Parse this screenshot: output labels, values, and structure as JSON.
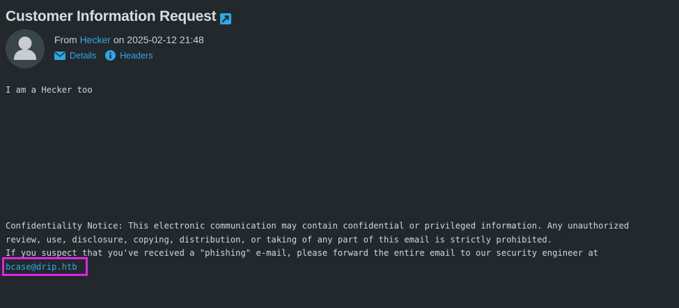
{
  "message": {
    "subject": "Customer Information Request",
    "from_prefix": "From",
    "from_name": "Hecker",
    "date_prefix": "on",
    "date": "2025-02-12 21:48",
    "links": {
      "details": "Details",
      "headers": "Headers"
    },
    "body_text": "I am a Hecker too",
    "notice_lines": [
      "Confidentiality Notice: This electronic communication may contain confidential or privileged information. Any unauthorized",
      "review, use, disclosure, copying, distribution, or taking of any part of this email is strictly prohibited.",
      "If you suspect that you've received a \"phishing\" e-mail, please forward the entire email to our security engineer at"
    ],
    "security_email": "bcase@drip.htb"
  },
  "colors": {
    "background": "#22282c",
    "link": "#2ea9e6",
    "highlight": "#e024e8"
  },
  "icons": {
    "open_external": "external-link-icon",
    "avatar": "user-avatar-icon",
    "details": "envelope-icon",
    "headers": "info-circle-icon"
  }
}
